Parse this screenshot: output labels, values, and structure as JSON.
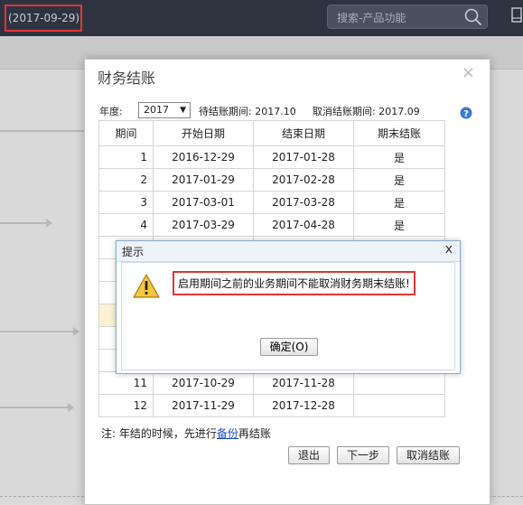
{
  "topbar": {
    "date_text": "(2017-09-29)",
    "search_placeholder": "搜索-产品功能",
    "search_icon": "search-icon",
    "device_icon": "device-icon"
  },
  "dialog": {
    "title": "财务结账",
    "close_glyph": "×",
    "year_label": "年度:",
    "year_value": "2017",
    "pending_period": "待结账期间: 2017.10",
    "cancel_period": "取消结账期间: 2017.09",
    "help_icon": "help-icon",
    "table": {
      "headers": [
        "期间",
        "开始日期",
        "结束日期",
        "期末结账"
      ],
      "rows": [
        {
          "period": "1",
          "start": "2016-12-29",
          "end": "2017-01-28",
          "closed": "是"
        },
        {
          "period": "2",
          "start": "2017-01-29",
          "end": "2017-02-28",
          "closed": "是"
        },
        {
          "period": "3",
          "start": "2017-03-01",
          "end": "2017-03-28",
          "closed": "是"
        },
        {
          "period": "4",
          "start": "2017-03-29",
          "end": "2017-04-28",
          "closed": "是"
        },
        {
          "period": "",
          "start": "",
          "end": "",
          "closed": ""
        },
        {
          "period": "",
          "start": "",
          "end": "",
          "closed": ""
        },
        {
          "period": "",
          "start": "",
          "end": "",
          "closed": ""
        },
        {
          "period": "",
          "start": "",
          "end": "",
          "closed": ""
        },
        {
          "period": "",
          "start": "",
          "end": "",
          "closed": ""
        },
        {
          "period": "",
          "start": "",
          "end": "",
          "closed": ""
        },
        {
          "period": "11",
          "start": "2017-10-29",
          "end": "2017-11-28",
          "closed": ""
        },
        {
          "period": "12",
          "start": "2017-11-29",
          "end": "2017-12-28",
          "closed": ""
        }
      ]
    },
    "note_prefix": "注: 年结的时候，先进行",
    "note_link": "备份",
    "note_suffix": "再结账",
    "buttons": {
      "exit": "退出",
      "next": "下一步",
      "cancel_close": "取消结账"
    }
  },
  "alert": {
    "title": "提示",
    "close_glyph": "x",
    "message": "启用期间之前的业务期间不能取消财务期末结账!",
    "ok_label": "确定(O)",
    "warning_icon": "warning-icon"
  },
  "colors": {
    "topbar_bg": "#2e3340",
    "highlight_border": "#e0363a",
    "alert_border": "#8aaad3",
    "row_highlight": "#fdf1d2"
  }
}
